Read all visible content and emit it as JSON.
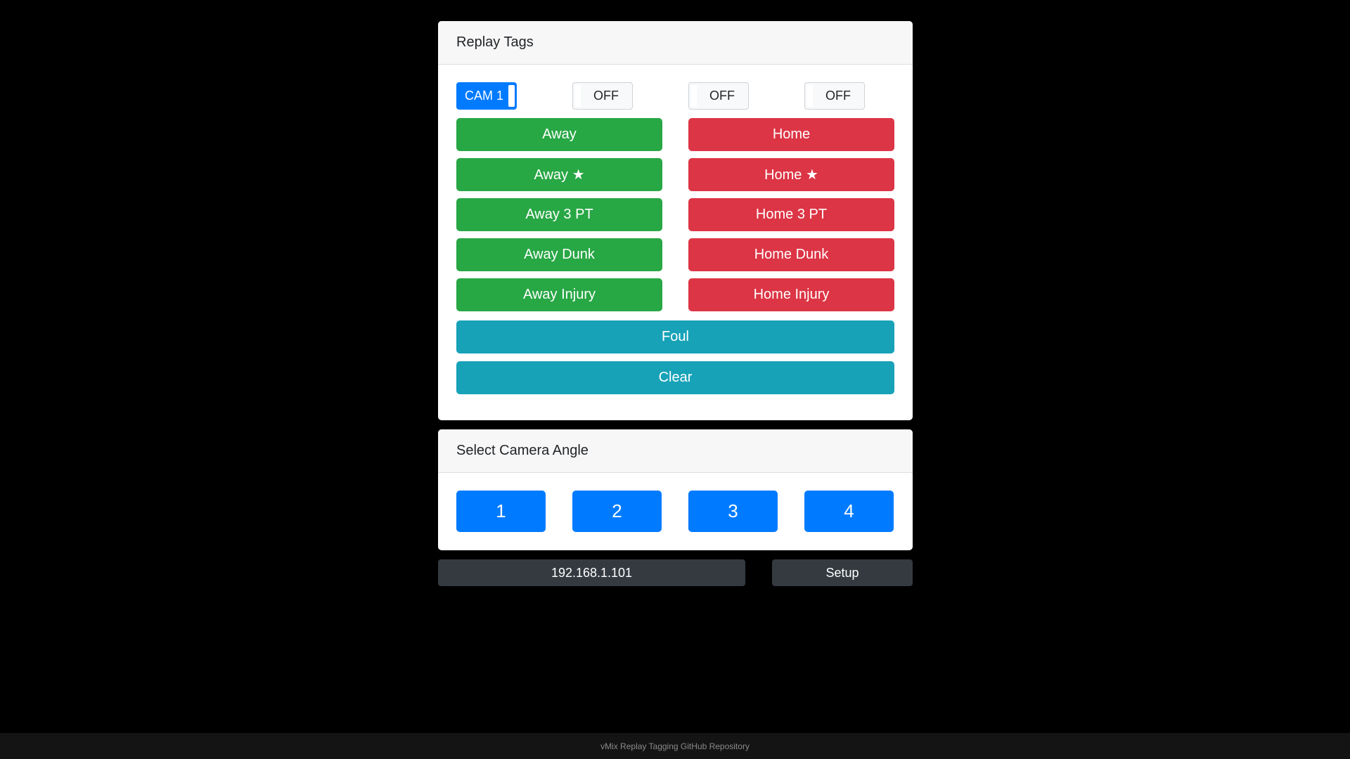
{
  "tags_card": {
    "title": "Replay Tags",
    "toggles": [
      {
        "label": "CAM 1",
        "state": "on"
      },
      {
        "label": "OFF",
        "state": "off"
      },
      {
        "label": "OFF",
        "state": "off"
      },
      {
        "label": "OFF",
        "state": "off"
      }
    ],
    "away_buttons": [
      "Away",
      "Away ★",
      "Away 3 PT",
      "Away Dunk",
      "Away Injury"
    ],
    "home_buttons": [
      "Home",
      "Home ★",
      "Home 3 PT",
      "Home Dunk",
      "Home Injury"
    ],
    "foul_label": "Foul",
    "clear_label": "Clear"
  },
  "camera_card": {
    "title": "Select Camera Angle",
    "buttons": [
      "1",
      "2",
      "3",
      "4"
    ]
  },
  "bottom": {
    "ip_label": "192.168.1.101",
    "setup_label": "Setup"
  },
  "footer": {
    "link_text": "vMix Replay Tagging GitHub Repository"
  },
  "colors": {
    "away": "#28a745",
    "home": "#dc3545",
    "info": "#17a2b8",
    "primary": "#007bff",
    "dark": "#343a40"
  }
}
